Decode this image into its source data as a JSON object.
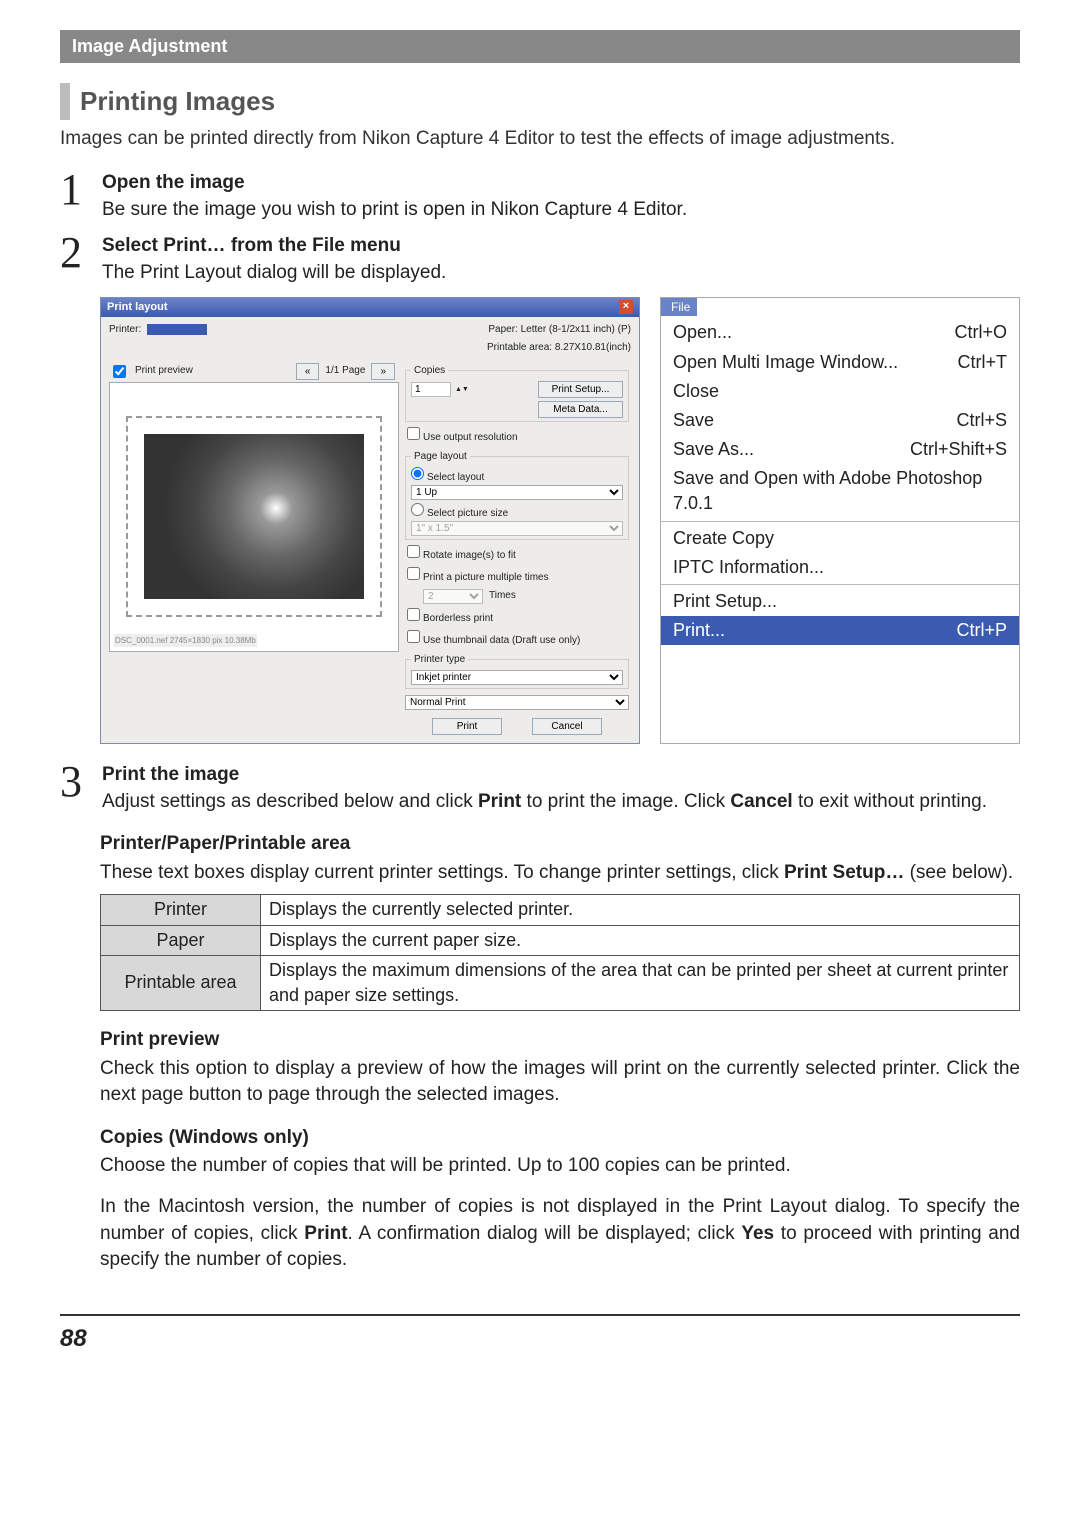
{
  "sectionBar": "Image Adjustment",
  "heading": "Printing Images",
  "intro": "Images can be printed directly from Nikon Capture 4 Editor to test the effects of image adjustments.",
  "steps": [
    {
      "num": "1",
      "title": "Open the image",
      "desc": "Be sure the image you wish to print is open in Nikon Capture 4 Editor."
    },
    {
      "num": "2",
      "title_pre": "Select ",
      "title_b": "Print…",
      "title_mid": " from the ",
      "title_b2": "File",
      "title_post": " menu",
      "desc": "The Print Layout dialog will be displayed."
    }
  ],
  "dlg": {
    "title": "Print layout",
    "printerLabel": "Printer:",
    "paperLabel": "Paper: Letter (8-1/2x11 inch) (P)",
    "printableArea": "Printable area: 8.27X10.81(inch)",
    "printPreview": "Print preview",
    "pageDisplay": "1/1 Page",
    "copiesLegend": "Copies",
    "copiesVal": "1",
    "printSetupBtn": "Print Setup...",
    "metaBtn": "Meta Data...",
    "useOutputRes": "Use output resolution",
    "pageLayoutLegend": "Page layout",
    "selectLayout": "Select layout",
    "layoutOpt": "1 Up",
    "selectPicSize": "Select picture size",
    "picSizeOpt": "1\" x 1.5\"",
    "rotate": "Rotate image(s) to fit",
    "printMultiple": "Print a picture multiple times",
    "multipleVal": "2",
    "timesLabel": "Times",
    "borderless": "Borderless print",
    "useThumb": "Use thumbnail data (Draft use only)",
    "printerTypeLegend": "Printer type",
    "printerTypeOpt": "Inkjet printer",
    "normalPrint": "Normal Print",
    "printBtn": "Print",
    "cancelBtn": "Cancel"
  },
  "fileMenu": {
    "file": "File",
    "items": [
      {
        "label": "Open...",
        "acc": "Ctrl+O"
      },
      {
        "label": "Open Multi Image Window...",
        "acc": "Ctrl+T"
      },
      {
        "label": "Close",
        "acc": ""
      },
      {
        "label": "Save",
        "acc": "Ctrl+S"
      },
      {
        "label": "Save As...",
        "acc": "Ctrl+Shift+S"
      },
      {
        "label": "Save and Open with Adobe Photoshop 7.0.1",
        "acc": ""
      }
    ],
    "items2": [
      {
        "label": "Create Copy",
        "acc": ""
      },
      {
        "label": "IPTC Information...",
        "acc": ""
      }
    ],
    "items3": [
      {
        "label": "Print Setup...",
        "acc": ""
      }
    ],
    "selected": {
      "label": "Print...",
      "acc": "Ctrl+P"
    }
  },
  "step3": {
    "num": "3",
    "title": "Print the image",
    "desc_pre": "Adjust settings as described below and click ",
    "b1": "Print",
    "desc_mid": " to print the image. Click ",
    "b2": "Cancel",
    "desc_post": " to exit without printing."
  },
  "printerArea": {
    "head": "Printer/Paper/Printable area",
    "body_pre": "These text boxes display current printer settings. To change printer settings, click ",
    "body_b": "Print Setup…",
    "body_post": " (see below).",
    "rows": [
      {
        "label": "Printer",
        "desc": "Displays the currently selected printer."
      },
      {
        "label": "Paper",
        "desc": "Displays the current paper size."
      },
      {
        "label": "Printable area",
        "desc": "Displays the maximum dimensions of the area that can be printed per sheet at current printer and paper size settings."
      }
    ]
  },
  "printPreview": {
    "head": "Print preview",
    "body": "Check this option to display a preview of how the images will print on the currently selected printer. Click the next page button to page through the selected images."
  },
  "copies": {
    "head": "Copies (Windows only)",
    "body1": "Choose the number of copies that will be printed. Up to 100 copies can be printed.",
    "body2_pre": "In the Macintosh version, the number of copies is not displayed in the Print Layout dialog. To specify the number of copies, click ",
    "body2_b1": "Print",
    "body2_mid": ". A confirmation dialog will be displayed; click ",
    "body2_b2": "Yes",
    "body2_post": " to proceed with printing and specify the number of copies."
  },
  "pageNum": "88"
}
